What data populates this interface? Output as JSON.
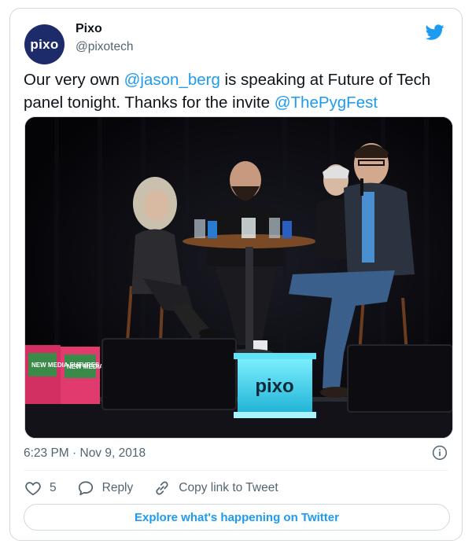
{
  "tweet": {
    "avatar_text": "pixo",
    "author_name": "Pixo",
    "author_handle": "@pixotech",
    "text_parts": {
      "p1": "Our very own ",
      "mention1": "@jason_berg",
      "p2": " is speaking at Future of Tech panel tonight. Thanks for the invite ",
      "mention2": "@ThePygFest"
    },
    "timestamp": "6:23 PM · Nov 9, 2018",
    "media": {
      "podium_text": "pixo",
      "book_title": "NEW MEDIA FUTURES"
    },
    "actions": {
      "like_count": "5",
      "reply_label": "Reply",
      "copy_label": "Copy link to Tweet"
    },
    "explore_label": "Explore what's happening on Twitter"
  },
  "colors": {
    "accent": "#1d9bf0",
    "avatar_bg": "#1d2b6b",
    "podium_glow": "#3fd6ee"
  },
  "icons": [
    "twitter-bird-icon",
    "info-icon",
    "heart-icon",
    "reply-icon",
    "link-icon"
  ]
}
